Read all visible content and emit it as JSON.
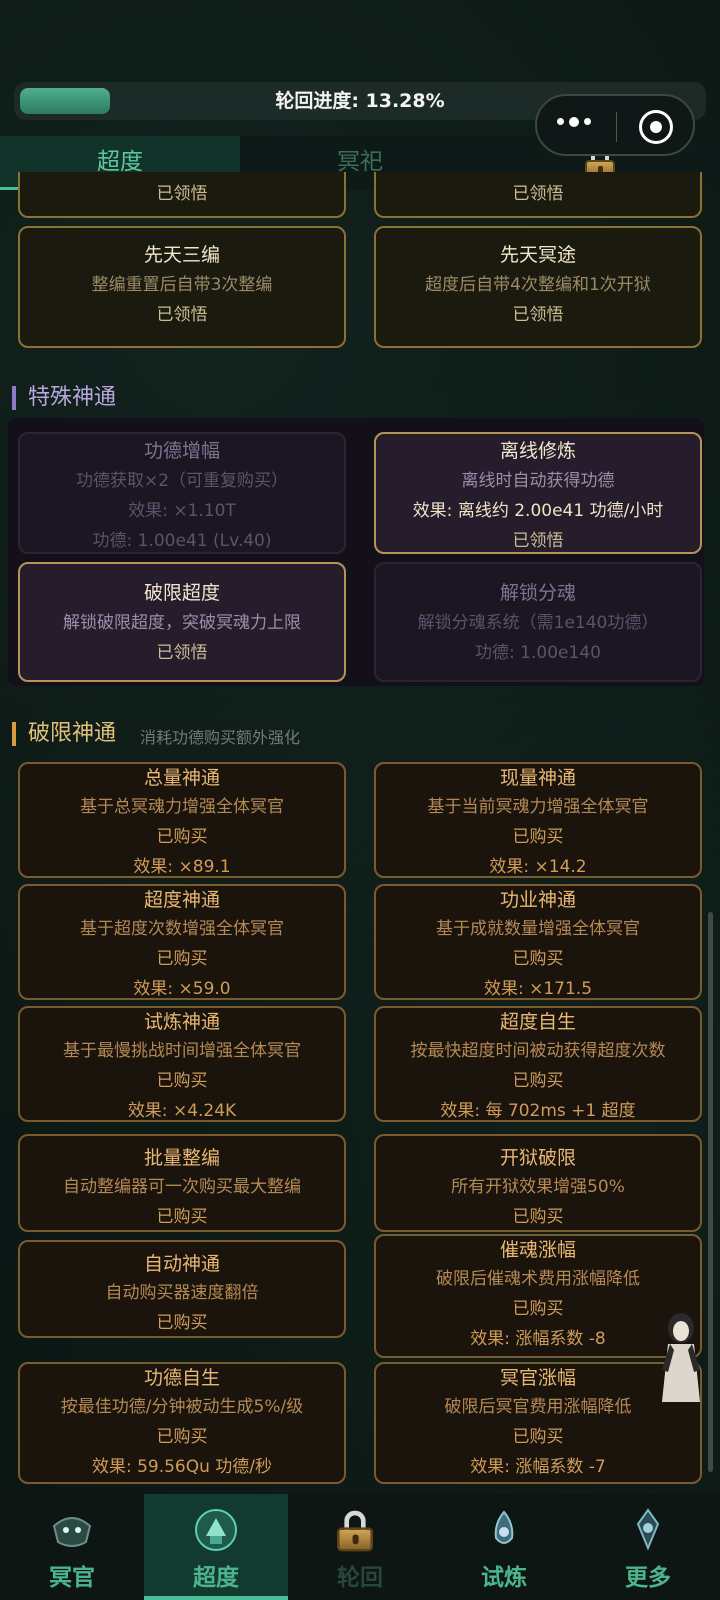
{
  "progress": {
    "label": "轮回进度: 13.28%",
    "fraction": 0.1328
  },
  "tabs": [
    {
      "label": "超度",
      "active": true
    },
    {
      "label": "冥祀",
      "active": false
    },
    {
      "label": "",
      "locked": true
    }
  ],
  "top_cards": [
    {
      "title": "",
      "desc": "",
      "status": "已领悟"
    },
    {
      "title": "",
      "desc": "",
      "status": "已领悟"
    },
    {
      "title": "先天三编",
      "desc": "整编重置后自带3次整编",
      "status": "已领悟"
    },
    {
      "title": "先天冥途",
      "desc": "超度后自带4次整编和1次开狱",
      "status": "已领悟"
    }
  ],
  "special": {
    "title": "特殊神通",
    "cards": [
      {
        "title": "功德增幅",
        "desc": "功德获取×2（可重复购买）",
        "effect": "效果: ×1.10T",
        "cost": "功德: 1.00e41 (Lv.40)"
      },
      {
        "title": "离线修炼",
        "desc": "离线时自动获得功德",
        "effect": "效果: 离线约 2.00e41 功德/小时",
        "status": "已领悟"
      },
      {
        "title": "破限超度",
        "desc": "解锁破限超度，突破冥魂力上限",
        "status": "已领悟"
      },
      {
        "title": "解锁分魂",
        "desc": "解锁分魂系统（需1e140功德）",
        "cost": "功德: 1.00e140"
      }
    ]
  },
  "breakthrough": {
    "title": "破限神通",
    "subtitle": "消耗功德购买额外强化",
    "cards": [
      {
        "title": "总量神通",
        "desc": "基于总冥魂力增强全体冥官",
        "status": "已购买",
        "effect": "效果: ×89.1"
      },
      {
        "title": "现量神通",
        "desc": "基于当前冥魂力增强全体冥官",
        "status": "已购买",
        "effect": "效果: ×14.2"
      },
      {
        "title": "超度神通",
        "desc": "基于超度次数增强全体冥官",
        "status": "已购买",
        "effect": "效果: ×59.0"
      },
      {
        "title": "功业神通",
        "desc": "基于成就数量增强全体冥官",
        "status": "已购买",
        "effect": "效果: ×171.5"
      },
      {
        "title": "试炼神通",
        "desc": "基于最慢挑战时间增强全体冥官",
        "status": "已购买",
        "effect": "效果: ×4.24K"
      },
      {
        "title": "超度自生",
        "desc": "按最快超度时间被动获得超度次数",
        "status": "已购买",
        "effect": "效果: 每 702ms +1 超度"
      },
      {
        "title": "批量整编",
        "desc": "自动整编器可一次购买最大整编",
        "status": "已购买"
      },
      {
        "title": "开狱破限",
        "desc": "所有开狱效果增强50%",
        "status": "已购买"
      },
      {
        "title": "自动神通",
        "desc": "自动购买器速度翻倍",
        "status": "已购买"
      },
      {
        "title": "催魂涨幅",
        "desc": "破限后催魂术费用涨幅降低",
        "status": "已购买",
        "effect": "效果: 涨幅系数 -8"
      },
      {
        "title": "功德自生",
        "desc": "按最佳功德/分钟被动生成5%/级",
        "status": "已购买",
        "effect": "效果: 59.56Qu 功德/秒"
      },
      {
        "title": "冥官涨幅",
        "desc": "破限后冥官费用涨幅降低",
        "status": "已购买",
        "effect": "效果: 涨幅系数 -7"
      }
    ]
  },
  "bottom_nav": [
    {
      "label": "冥官",
      "icon": "underworld-official-icon"
    },
    {
      "label": "超度",
      "icon": "salvation-icon",
      "active": true
    },
    {
      "label": "轮回",
      "icon": "reincarnation-icon",
      "locked": true
    },
    {
      "label": "试炼",
      "icon": "trial-icon"
    },
    {
      "label": "更多",
      "icon": "more-icon"
    }
  ]
}
